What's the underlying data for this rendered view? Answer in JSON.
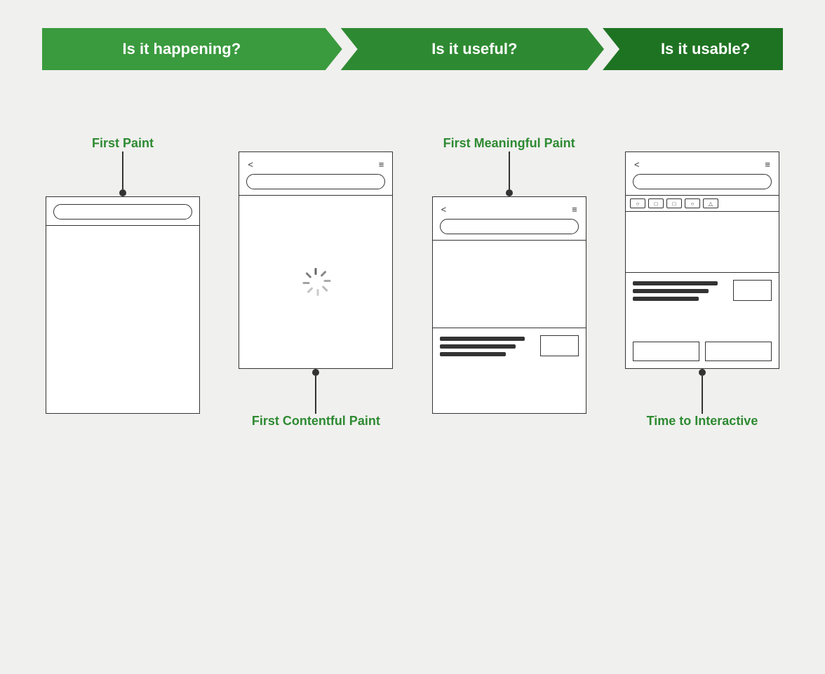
{
  "banner": {
    "segment1": "Is it happening?",
    "segment2": "Is it useful?",
    "segment3": "Is it usable?"
  },
  "metrics": [
    {
      "id": "first-paint",
      "label": "First Paint",
      "position": "above",
      "mockup_type": "header_only"
    },
    {
      "id": "first-contentful-paint",
      "label": "First Contentful Paint",
      "position": "below",
      "mockup_type": "loading"
    },
    {
      "id": "first-meaningful-paint",
      "label": "First Meaningful Paint",
      "position": "above",
      "mockup_type": "content"
    },
    {
      "id": "time-to-interactive",
      "label": "Time to Interactive",
      "position": "below",
      "mockup_type": "interactive"
    }
  ],
  "nav_back": "<",
  "nav_menu": "≡",
  "tab_shapes": [
    "○",
    "□",
    "□",
    "○",
    "△"
  ]
}
